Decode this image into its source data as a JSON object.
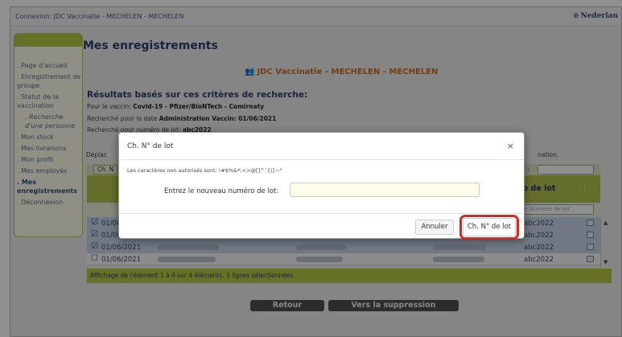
{
  "topbar": {
    "connection_text": "Connexion: JDC Vaccinatie - MECHELEN - MECHELEN",
    "language": "Nederlan"
  },
  "sidebar": {
    "items": [
      {
        "label": ". Page d'accueil"
      },
      {
        "label": ". Enregistrement de groupe"
      },
      {
        "label": ". Statut de la vaccination"
      },
      {
        "label": ". Recherche d'une personne"
      },
      {
        "label": ". Mon stock"
      },
      {
        "label": ". Mes livraisons"
      },
      {
        "label": ". Mon profil"
      },
      {
        "label": ". Mes employés"
      },
      {
        "label": ". Mes enregistrements"
      },
      {
        "label": ". Déconnexion"
      }
    ]
  },
  "page": {
    "title": "Mes enregistrements",
    "center_title": "JDC Vaccinatie - MECHELEN - MECHELEN",
    "criteria_title": "Résultats basés sur ces critères de recherche:",
    "criteria": [
      {
        "label": "Pour le vaccin:",
        "value": "Covid-19 - Pfizer/BioNTech - Comirnaty"
      },
      {
        "label": "Recherché pour la date",
        "value": "Administration Vaccin: 01/06/2021"
      },
      {
        "label": "Recherché pour numéro de lot:",
        "value": "abc2022"
      }
    ],
    "deplac_text": "Déplac",
    "deplac_right": "nation."
  },
  "table": {
    "toolbar_button": "Ch. N",
    "filter_label": "er :",
    "header_lot": "ro de lot",
    "lot_filter_placeholder": "ne Numéro de lot",
    "rows": [
      {
        "date": "01/06/2021",
        "lot": "abc2022",
        "selected": true
      },
      {
        "date": "01/06/2021",
        "lot": "abc2022",
        "selected": true
      },
      {
        "date": "01/06/2021",
        "lot": "abc2022",
        "selected": true
      },
      {
        "date": "01/06/2021",
        "lot": "abc2022",
        "selected": false
      }
    ],
    "status": "Affichage de l'élément 1 à 4 sur 4 éléments.    3 lignes sélectionnées."
  },
  "buttons": {
    "back": "Retour",
    "to_delete": "Vers la suppression"
  },
  "dialog": {
    "title": "Ch. N° de lot",
    "close": "×",
    "note": "Les caractères non autorisés sont: !#$%&*;<>@[]^`{|}~\"",
    "field_label": "Entrez le nouveau numéro de lot:",
    "field_value": "",
    "cancel": "Annuler",
    "confirm": "Ch. N° de lot"
  }
}
